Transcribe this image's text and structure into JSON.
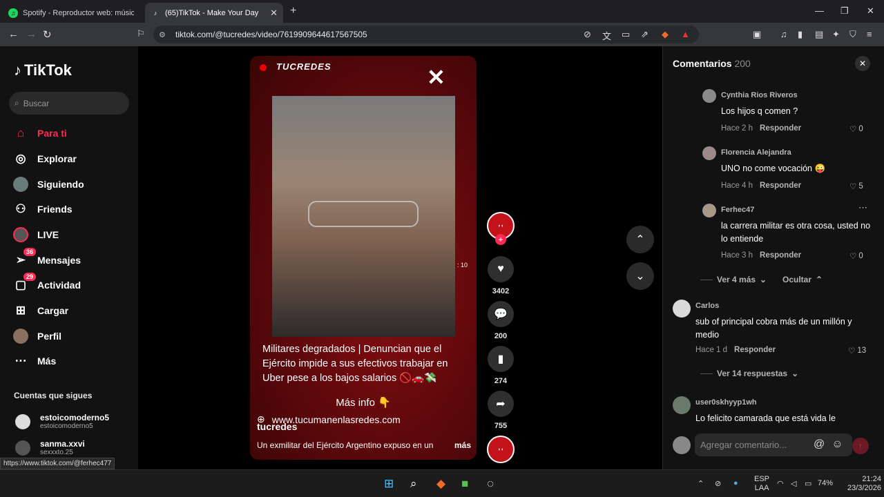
{
  "browser": {
    "tabs": [
      {
        "title": "Spotify - Reproductor web: música p"
      },
      {
        "title": "(65)TikTok - Make Your Day"
      }
    ],
    "url": "tiktok.com/@tucredes/video/7619909644617567505"
  },
  "sidebar": {
    "logo": "TikTok",
    "search_placeholder": "Buscar",
    "items": [
      {
        "label": "Para ti"
      },
      {
        "label": "Explorar"
      },
      {
        "label": "Siguiendo"
      },
      {
        "label": "Friends"
      },
      {
        "label": "LIVE"
      },
      {
        "label": "Mensajes",
        "badge": "36"
      },
      {
        "label": "Actividad",
        "badge": "29"
      },
      {
        "label": "Cargar"
      },
      {
        "label": "Perfil"
      },
      {
        "label": "Más"
      }
    ],
    "following_header": "Cuentas que sigues",
    "following": [
      {
        "name": "estoicomoderno5",
        "handle": "estoicomoderno5"
      },
      {
        "name": "sanma.xxvi",
        "handle": "sexxxto.25"
      }
    ],
    "status_url": "https://www.tiktok.com/@ferhec477"
  },
  "video": {
    "brand": "TUCREDES",
    "caption": "Militares degradados | Denuncian que el Ejército impide a sus efectivos trabajar en Uber pese a los bajos salarios 🚫🚗💸",
    "more_info": "Más info 👇",
    "site": "www.tucumanenlasredes.com",
    "username": "tucredes",
    "description": "Un exmilitar del Ejército Argentino expuso en un",
    "more": "más",
    "timestamp": ": 10"
  },
  "actions": {
    "likes": "3402",
    "comments": "200",
    "saves": "274",
    "shares": "755"
  },
  "comments_panel": {
    "title": "Comentarios",
    "count": "200",
    "items": [
      {
        "user": "Cynthia Rios Riveros",
        "text": "Los hijos q comen ?",
        "time": "Hace 2 h",
        "reply": "Responder",
        "likes": "0"
      },
      {
        "user": "Florencia Alejandra",
        "text": "UNO no come vocación 😜",
        "time": "Hace 4 h",
        "reply": "Responder",
        "likes": "5"
      },
      {
        "user": "Ferhec47",
        "text": "la carrera militar es otra cosa, usted no lo entiende",
        "time": "Hace 3 h",
        "reply": "Responder",
        "likes": "0"
      },
      {
        "user": "Carlos",
        "text": "sub of principal cobra más de un millón y medio",
        "time": "Hace 1 d",
        "reply": "Responder",
        "likes": "13"
      },
      {
        "user": "user0skhyyp1wh",
        "text": "Lo felicito camarada que está vida le"
      }
    ],
    "view_more": "Ver 4 más",
    "hide": "Ocultar",
    "view_replies": "Ver 14 respuestas",
    "input_placeholder": "Agregar comentario..."
  },
  "taskbar": {
    "lang": "ESP",
    "lang2": "LAA",
    "battery": "74%",
    "time": "21:24",
    "date": "23/3/2026"
  }
}
